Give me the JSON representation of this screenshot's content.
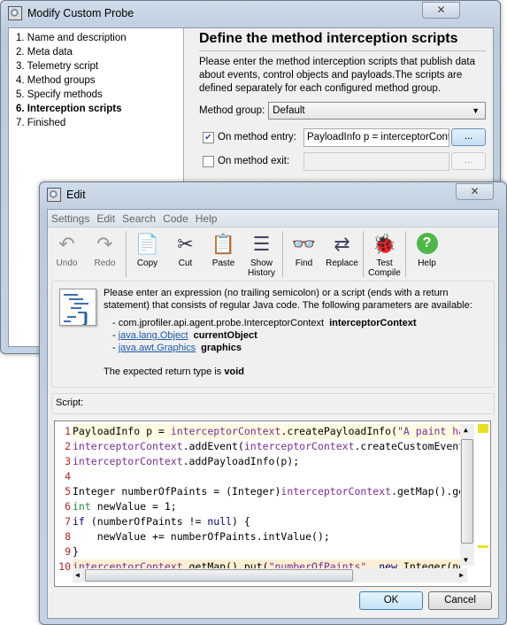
{
  "outer": {
    "title": "Modify Custom Probe",
    "close": "✕",
    "steps": [
      {
        "label": "1. Name and description"
      },
      {
        "label": "2. Meta data"
      },
      {
        "label": "3. Telemetry script"
      },
      {
        "label": "4. Method groups"
      },
      {
        "label": "5. Specify methods"
      },
      {
        "label": "6. Interception scripts",
        "current": true
      },
      {
        "label": "7. Finished"
      }
    ],
    "heading": "Define the method interception scripts",
    "description": "Please enter the method interception scripts that publish data about events, control objects and payloads.The scripts are defined separately for each configured method group.",
    "method_group_label": "Method group:",
    "method_group_value": "Default",
    "entry": {
      "label": "On method entry:",
      "checked": true,
      "value": "PayloadInfo p = interceptorContext",
      "button": "..."
    },
    "exit": {
      "label": "On method exit:",
      "checked": false,
      "value": "",
      "button": "..."
    }
  },
  "edit": {
    "title": "Edit",
    "close": "✕",
    "menu": [
      "Settings",
      "Edit",
      "Search",
      "Code",
      "Help"
    ],
    "toolbar": [
      {
        "label": "Undo",
        "icon": "undo-icon",
        "enabled": false
      },
      {
        "label": "Redo",
        "icon": "redo-icon",
        "enabled": false
      },
      {
        "label": "Copy",
        "icon": "copy-icon"
      },
      {
        "label": "Cut",
        "icon": "scissors-icon"
      },
      {
        "label": "Paste",
        "icon": "clipboard-icon"
      },
      {
        "label": "Show History",
        "icon": "history-icon"
      },
      {
        "label": "Find",
        "icon": "binoculars-icon"
      },
      {
        "label": "Replace",
        "icon": "replace-icon"
      },
      {
        "label": "Test Compile",
        "icon": "bug-icon"
      },
      {
        "label": "Help",
        "icon": "help-icon"
      }
    ],
    "info": {
      "text": "Please enter an expression (no trailing semicolon) or a script (ends with a return statement) that consists of regular Java code. The following parameters are available:",
      "params": [
        {
          "type": "com.jprofiler.api.agent.probe.InterceptorContext",
          "link": false,
          "name": "interceptorContext"
        },
        {
          "type": "java.lang.Object",
          "link": true,
          "name": "currentObject"
        },
        {
          "type": "java.awt.Graphics",
          "link": true,
          "name": "graphics"
        }
      ],
      "return_prefix": "The expected return type is ",
      "return_type": "void"
    },
    "script_label": "Script:",
    "code": [
      [
        [
          "p",
          "PayloadInfo p = "
        ],
        [
          "v",
          "interceptorContext"
        ],
        [
          "p",
          ".createPayloadInfo("
        ],
        [
          "v",
          "\"A paint ha"
        ]
      ],
      [
        [
          "v",
          "interceptorContext"
        ],
        [
          "p",
          ".addEvent("
        ],
        [
          "v",
          "interceptorContext"
        ],
        [
          "p",
          ".createCustomEvent"
        ]
      ],
      [
        [
          "v",
          "interceptorContext"
        ],
        [
          "p",
          ".addPayloadInfo(p);"
        ]
      ],
      [],
      [
        [
          "p",
          "Integer numberOfPaints = (Integer)"
        ],
        [
          "v",
          "interceptorContext"
        ],
        [
          "p",
          ".getMap().ge"
        ]
      ],
      [
        [
          "k",
          "int"
        ],
        [
          "p",
          " newValue = 1;"
        ]
      ],
      [
        [
          "b",
          "if"
        ],
        [
          "p",
          " (numberOfPaints != "
        ],
        [
          "b",
          "null"
        ],
        [
          "p",
          ") {"
        ]
      ],
      [
        [
          "p",
          "    newValue += numberOfPaints.intValue();"
        ]
      ],
      [
        [
          "p",
          "}"
        ]
      ],
      [
        [
          "v",
          "interceptorContext"
        ],
        [
          "p",
          ".getMap().put("
        ],
        [
          "v",
          "\"numberOfPaints\""
        ],
        [
          "p",
          ", "
        ],
        [
          "b",
          "new"
        ],
        [
          "p",
          " Integer(ne"
        ]
      ]
    ],
    "ok": "OK",
    "cancel": "Cancel"
  }
}
